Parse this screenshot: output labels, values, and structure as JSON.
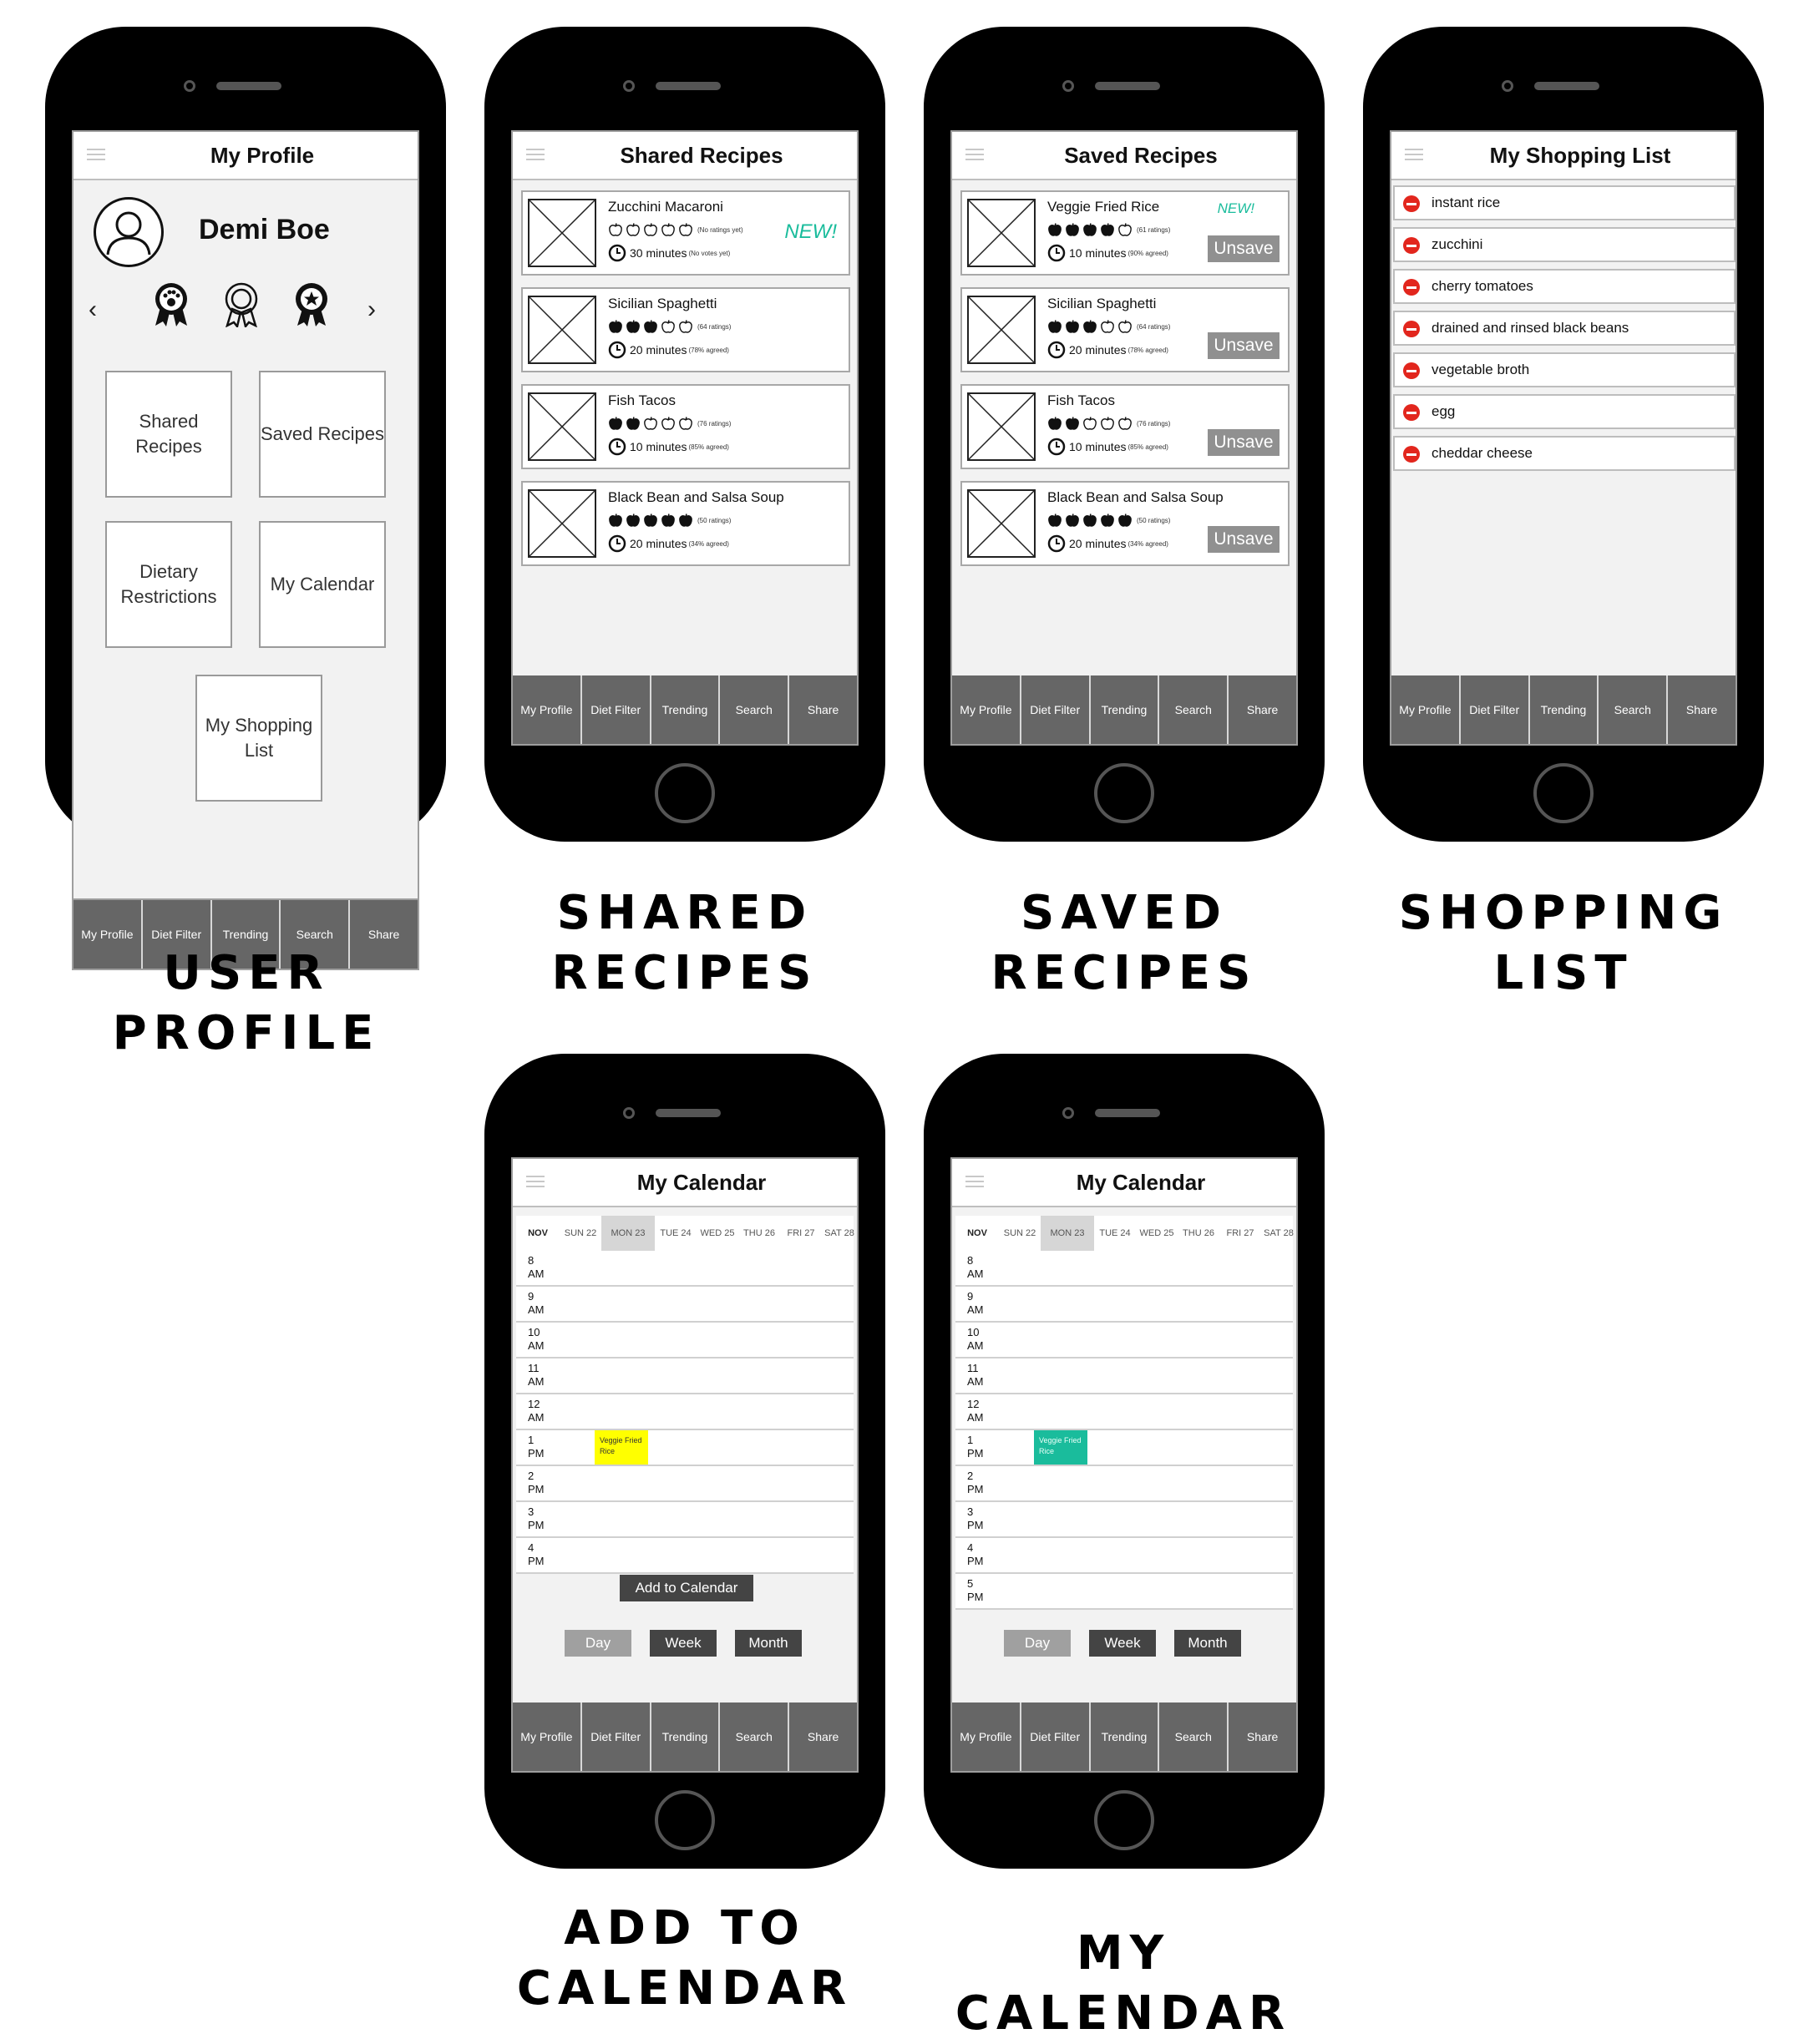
{
  "colors": {
    "accent_teal": "#1abc9c",
    "event_yellow": "#ffff00",
    "remove_red": "#e2261d",
    "navbar": "#666666"
  },
  "nav": [
    "My Profile",
    "Diet Filter",
    "Trending",
    "Search",
    "Share"
  ],
  "captions": {
    "profile": "USER PROFILE",
    "shared": [
      "SHARED",
      "RECIPES"
    ],
    "saved": [
      "SAVED",
      "RECIPES"
    ],
    "shopping": [
      "SHOPPING",
      "LIST"
    ],
    "add_cal": [
      "ADD TO",
      "CALENDAR"
    ],
    "my_cal": "MY CALENDAR"
  },
  "profile": {
    "title": "My Profile",
    "name": "Demi Boe",
    "tiles": [
      "Shared Recipes",
      "Saved Recipes",
      "Dietary Restrictions",
      "My Calendar",
      "My Shopping List"
    ],
    "badges": [
      "paw-badge-icon",
      "ribbon-badge-icon",
      "star-badge-icon"
    ]
  },
  "shared": {
    "title": "Shared  Recipes",
    "new_label": "NEW!",
    "recipes": [
      {
        "name": "Zucchini Macaroni",
        "rating": 0,
        "ratings_text": "(No ratings yet)",
        "minutes": "30 minutes",
        "agree_text": "(No votes yet)"
      },
      {
        "name": "Sicilian Spaghetti",
        "rating": 3,
        "ratings_text": "(64 ratings)",
        "minutes": "20 minutes",
        "agree_text": "(78% agreed)"
      },
      {
        "name": "Fish Tacos",
        "rating": 2,
        "ratings_text": "(76 ratings)",
        "minutes": "10 minutes",
        "agree_text": "(85% agreed)"
      },
      {
        "name": "Black Bean and Salsa Soup",
        "rating": 5,
        "ratings_text": "(50 ratings)",
        "minutes": "20 minutes",
        "agree_text": "(34% agreed)"
      }
    ]
  },
  "saved": {
    "title": "Saved Recipes",
    "new_label": "NEW!",
    "unsave_label": "Unsave",
    "recipes": [
      {
        "name": "Veggie Fried Rice",
        "rating": 4,
        "ratings_text": "(61 ratings)",
        "minutes": "10 minutes",
        "agree_text": "(90% agreed)"
      },
      {
        "name": "Sicilian Spaghetti",
        "rating": 3,
        "ratings_text": "(64 ratings)",
        "minutes": "20 minutes",
        "agree_text": "(78% agreed)"
      },
      {
        "name": "Fish Tacos",
        "rating": 2,
        "ratings_text": "(76 ratings)",
        "minutes": "10 minutes",
        "agree_text": "(85% agreed)"
      },
      {
        "name": "Black Bean and Salsa Soup",
        "rating": 5,
        "ratings_text": "(50 ratings)",
        "minutes": "20 minutes",
        "agree_text": "(34% agreed)"
      }
    ]
  },
  "shopping": {
    "title": "My Shopping List",
    "items": [
      "instant rice",
      "zucchini",
      "cherry tomatoes",
      "drained and rinsed black beans",
      "vegetable broth",
      "egg",
      "cheddar cheese"
    ]
  },
  "calendar": {
    "title": "My Calendar",
    "month": "NOV",
    "days": [
      "SUN 22",
      "MON 23",
      "TUE 24",
      "WED 25",
      "THU 26",
      "FRI 27",
      "SAT 28"
    ],
    "selected_day": "MON 23",
    "event": "Veggie Fried Rice",
    "add_button": "Add to Calendar",
    "views": [
      "Day",
      "Week",
      "Month"
    ],
    "hours_add": [
      [
        "8",
        "AM"
      ],
      [
        "9",
        "AM"
      ],
      [
        "10",
        "AM"
      ],
      [
        "11",
        "AM"
      ],
      [
        "12",
        "AM"
      ],
      [
        "1",
        "PM"
      ],
      [
        "2",
        "PM"
      ],
      [
        "3",
        "PM"
      ],
      [
        "4",
        "PM"
      ]
    ],
    "hours_my": [
      [
        "8",
        "AM"
      ],
      [
        "9",
        "AM"
      ],
      [
        "10",
        "AM"
      ],
      [
        "11",
        "AM"
      ],
      [
        "12",
        "AM"
      ],
      [
        "1",
        "PM"
      ],
      [
        "2",
        "PM"
      ],
      [
        "3",
        "PM"
      ],
      [
        "4",
        "PM"
      ],
      [
        "5",
        "PM"
      ]
    ]
  }
}
